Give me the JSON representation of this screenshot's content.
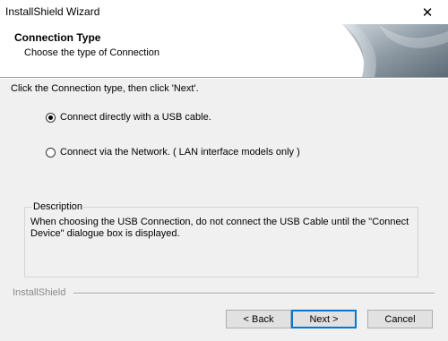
{
  "window": {
    "title": "InstallShield Wizard"
  },
  "header": {
    "title": "Connection Type",
    "subtitle": "Choose the type of Connection"
  },
  "instruction": "Click the Connection type, then click 'Next'.",
  "options": [
    {
      "label": "Connect directly with a USB cable.",
      "selected": true
    },
    {
      "label": "Connect via the Network. ( LAN interface models only )",
      "selected": false
    }
  ],
  "description": {
    "legend": "Description",
    "text": "When choosing the USB Connection, do not connect the USB Cable until the \"Connect Device\" dialogue box is displayed."
  },
  "footer": {
    "brand": "InstallShield",
    "back_label": "< Back",
    "next_label": "Next >",
    "cancel_label": "Cancel"
  },
  "icons": {
    "close": "close-icon",
    "radio": "radio-icon"
  },
  "colors": {
    "accent": "#0078d7",
    "background": "#f0f0f0"
  }
}
